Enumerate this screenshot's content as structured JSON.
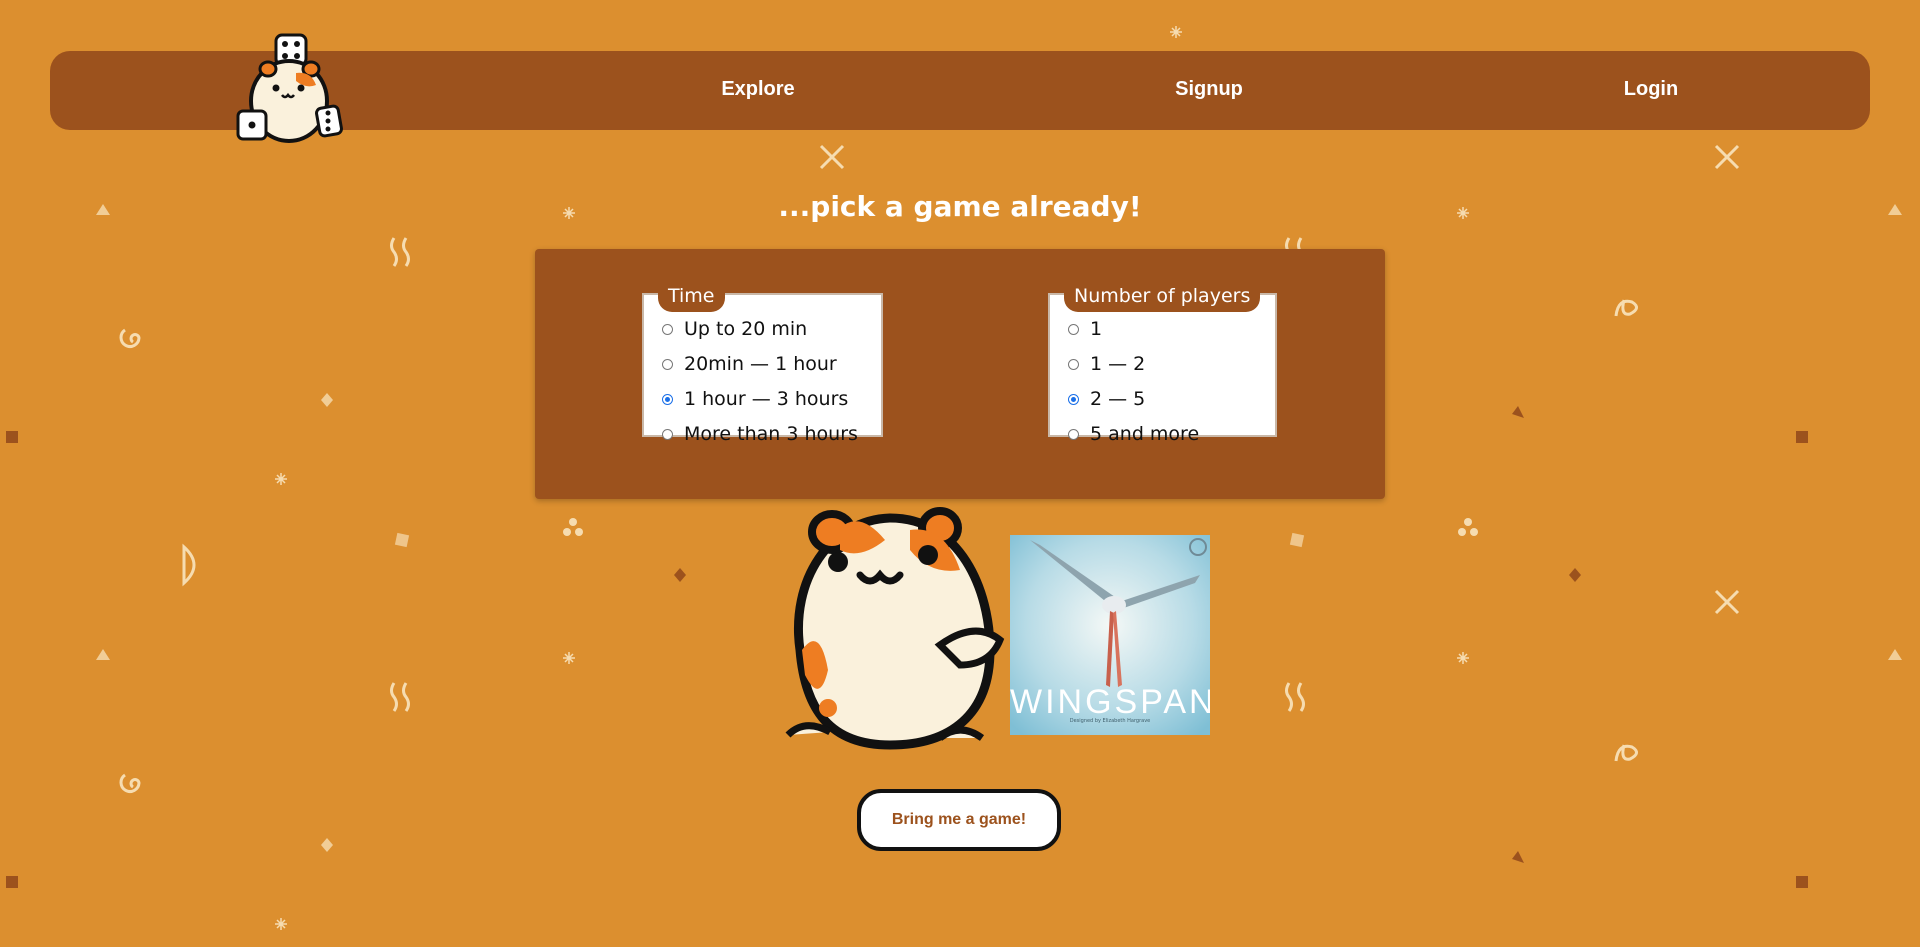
{
  "colors": {
    "background": "#dc8f2f",
    "panel": "#9c521d",
    "radio_checked": "#1a6fe8"
  },
  "header": {
    "logo_icon": "hamster-with-dice-icon",
    "nav": [
      {
        "label": "Explore"
      },
      {
        "label": "Signup"
      },
      {
        "label": "Login"
      }
    ]
  },
  "main": {
    "headline": "...pick a game already!",
    "filters": {
      "time": {
        "legend": "Time",
        "options": [
          "Up to 20 min",
          "20min — 1 hour",
          "1 hour — 3 hours",
          "More than 3 hours"
        ],
        "selected": "1 hour — 3 hours"
      },
      "players": {
        "legend": "Number of players",
        "options": [
          "1",
          "1 — 2",
          "2 — 5",
          "5 and more"
        ],
        "selected": "2 — 5"
      }
    },
    "mascot_icon": "hamster-mascot-icon",
    "game": {
      "title": "WINGSPAN",
      "subtitle": "Designed by Elizabeth Hargrave"
    },
    "cta_label": "Bring me a game!"
  }
}
